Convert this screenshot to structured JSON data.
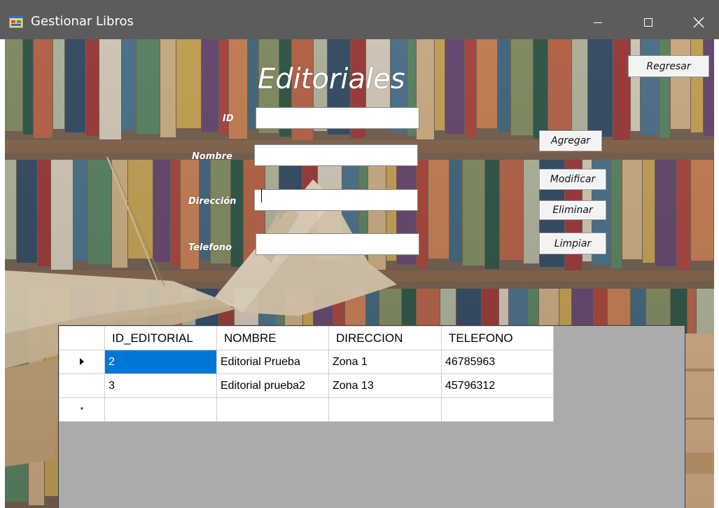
{
  "window": {
    "title": "Gestionar Libros",
    "icon": "app-window-icon",
    "controls": {
      "minimize": "minimize-icon",
      "maximize": "maximize-icon",
      "close": "close-icon"
    }
  },
  "form": {
    "heading": "Editoriales",
    "fields": [
      {
        "name": "id",
        "label": "ID",
        "value": ""
      },
      {
        "name": "nombre",
        "label": "Nombre",
        "value": ""
      },
      {
        "name": "direccion",
        "label": "Dirección",
        "value": ""
      },
      {
        "name": "telefono",
        "label": "Telefono",
        "value": ""
      }
    ]
  },
  "buttons": {
    "regresar": "Regresar",
    "agregar": "Agregar",
    "modificar": "Modificar",
    "eliminar": "Eliminar",
    "limpiar": "Limpiar"
  },
  "grid": {
    "columns": [
      "ID_EDITORIAL",
      "NOMBRE",
      "DIRECCION",
      "TELEFONO"
    ],
    "rows": [
      {
        "id": "2",
        "nombre": "Editorial Prueba",
        "direccion": "Zona 1",
        "telefono": "46785963",
        "current": true
      },
      {
        "id": "3",
        "nombre": "Editorial prueba2",
        "direccion": "Zona 13",
        "telefono": "45796312",
        "current": false
      }
    ],
    "new_row_marker": "*"
  },
  "colors": {
    "titlebar": "#5c5c5c",
    "selection": "#0078d7",
    "grid_background": "#ababab"
  }
}
